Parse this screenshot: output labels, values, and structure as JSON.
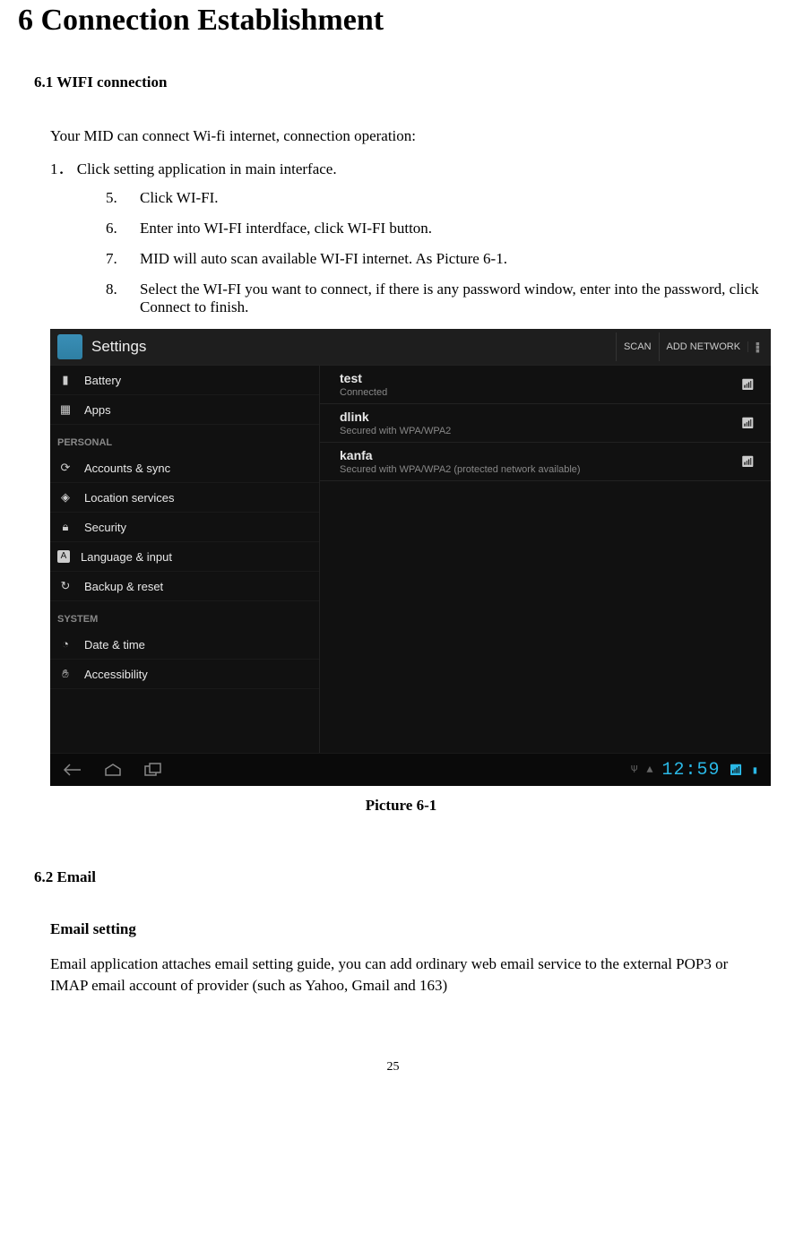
{
  "title": "6 Connection Establishment",
  "section61": {
    "heading": "6.1 WIFI connection",
    "intro": "Your MID can connect Wi-fi internet, connection operation:",
    "step1_num": "1．",
    "step1_text": "Click setting application in main interface.",
    "substeps": [
      {
        "num": "5.",
        "text": "Click WI-FI."
      },
      {
        "num": "6.",
        "text": "Enter into WI-FI interdface, click WI-FI button."
      },
      {
        "num": "7.",
        "text": "MID will auto scan available WI-FI internet. As Picture 6-1."
      },
      {
        "num": "8.",
        "text": "Select the WI-FI you want to connect, if there is any password window, enter into the password, click Connect to finish."
      }
    ]
  },
  "screenshot": {
    "app_title": "Settings",
    "scan": "SCAN",
    "add_network": "ADD NETWORK",
    "sidebar": {
      "items_top": [
        "Battery",
        "Apps"
      ],
      "header1": "PERSONAL",
      "items_personal": [
        "Accounts & sync",
        "Location services",
        "Security",
        "Language & input",
        "Backup & reset"
      ],
      "header2": "SYSTEM",
      "items_system": [
        "Date & time",
        "Accessibility"
      ]
    },
    "networks": [
      {
        "name": "test",
        "sub": "Connected"
      },
      {
        "name": "dlink",
        "sub": "Secured with WPA/WPA2"
      },
      {
        "name": "kanfa",
        "sub": "Secured with WPA/WPA2 (protected network available)"
      }
    ],
    "clock": "12:59"
  },
  "caption": "Picture 6-1",
  "section62": {
    "heading": "6.2 Email",
    "sub": "Email setting",
    "para": "Email application attaches email setting guide, you can add ordinary web email service to the external POP3 or IMAP email account of provider (such as Yahoo, Gmail and 163)"
  },
  "page_number": "25"
}
